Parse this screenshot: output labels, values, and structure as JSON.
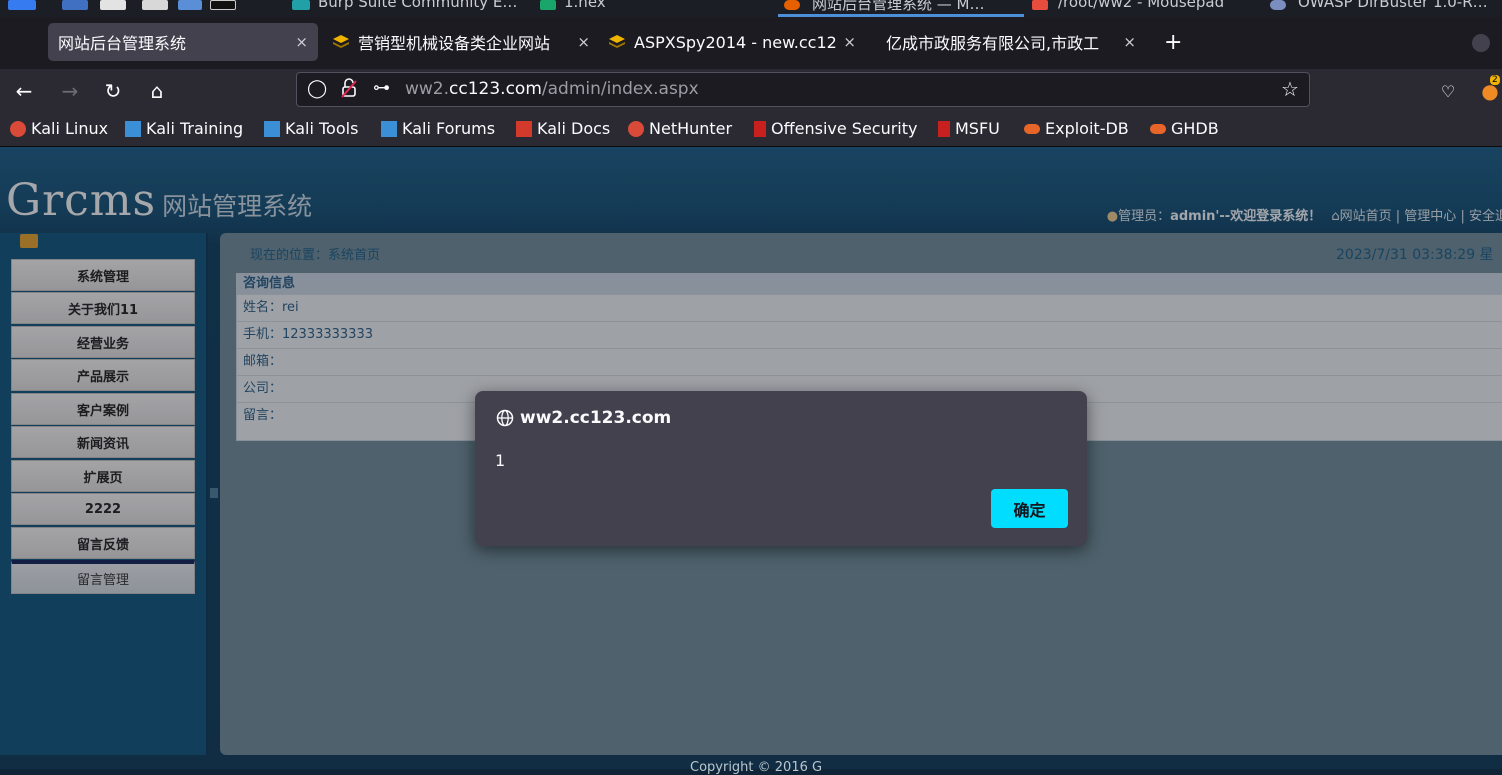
{
  "taskbar": {
    "items": [
      {
        "label": "Burp Suite Community E…"
      },
      {
        "label": "1.hex"
      },
      {
        "label": "网站后台管理系统 — M…"
      },
      {
        "label": "/root/ww2 - Mousepad"
      },
      {
        "label": "OWASP DirBuster 1.0-R…"
      }
    ]
  },
  "tabs": [
    {
      "title": "网站后台管理系统",
      "close": "×",
      "icon": "none"
    },
    {
      "title": "营销型机械设备类企业网站",
      "close": "×",
      "icon": "layers-icon"
    },
    {
      "title": "ASPXSpy2014 - new.cc123",
      "close": "×",
      "icon": "layers-icon"
    },
    {
      "title": "亿成市政服务有限公司,市政工",
      "close": "×",
      "icon": "none"
    }
  ],
  "new_tab": "+",
  "url": {
    "host_before": "ww2.",
    "host_main": "cc123.com",
    "path": "/admin/index.aspx"
  },
  "badge_count": "2",
  "bookmarks": [
    {
      "label": "Kali Linux",
      "icon": "kali-icon"
    },
    {
      "label": "Kali Training",
      "icon": "kali-training-icon"
    },
    {
      "label": "Kali Tools",
      "icon": "kali-tools-icon"
    },
    {
      "label": "Kali Forums",
      "icon": "kali-forums-icon"
    },
    {
      "label": "Kali Docs",
      "icon": "kali-docs-icon"
    },
    {
      "label": "NetHunter",
      "icon": "nethunter-icon"
    },
    {
      "label": "Offensive Security",
      "icon": "offsec-icon"
    },
    {
      "label": "MSFU",
      "icon": "msfu-icon"
    },
    {
      "label": "Exploit-DB",
      "icon": "exploitdb-icon"
    },
    {
      "label": "GHDB",
      "icon": "ghdb-icon"
    }
  ],
  "site": {
    "logo_main": "Grcms",
    "logo_sub": "网站管理系统",
    "admin_prefix": "管理员：",
    "admin_name": "admin'--欢迎登录系统！",
    "link_home": "网站首页",
    "sep1": "|",
    "link_center": "管理中心",
    "sep2": "|",
    "link_logout": "安全退"
  },
  "sidebar": {
    "items": [
      {
        "label": "系统管理"
      },
      {
        "label": "关于我们11"
      },
      {
        "label": "经营业务"
      },
      {
        "label": "产品展示"
      },
      {
        "label": "客户案例"
      },
      {
        "label": "新闻资讯"
      },
      {
        "label": "扩展页"
      },
      {
        "label": "2222"
      },
      {
        "label": "留言反馈"
      }
    ],
    "subitem": "留言管理"
  },
  "main": {
    "breadcrumb": "现在的位置：系统首页",
    "clock": "2023/7/31 03:38:29 星",
    "info_title": "咨询信息",
    "fields": [
      {
        "text": "姓名：rei"
      },
      {
        "text": "手机：12333333333"
      },
      {
        "text": "邮箱："
      },
      {
        "text": "公司："
      },
      {
        "text": "留言："
      }
    ]
  },
  "footer": "Copyright © 2016 G",
  "dialog": {
    "origin": "ww2.cc123.com",
    "message": "1",
    "ok": "确定"
  },
  "colors": {
    "accent": "#00ddff",
    "page_blue": "#155176",
    "dialog_bg": "#42414d"
  }
}
